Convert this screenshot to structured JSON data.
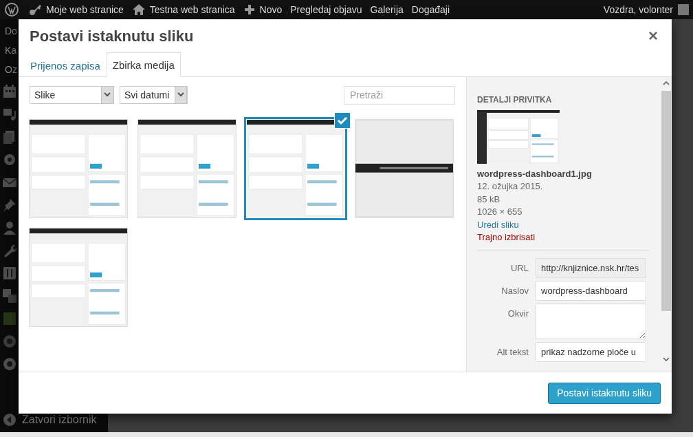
{
  "admin_bar": {
    "items": [
      {
        "kind": "logo"
      },
      {
        "kind": "sites",
        "label": "Moje web stranice"
      },
      {
        "kind": "home",
        "label": "Testna web stranica"
      },
      {
        "kind": "new",
        "label": "Novo"
      },
      {
        "kind": "link",
        "label": "Pregledaj objavu"
      },
      {
        "kind": "link",
        "label": "Galerija"
      },
      {
        "kind": "link",
        "label": "Događaji"
      }
    ],
    "user": "Vozdra, volonter"
  },
  "admin_menu": {
    "items": [
      "Do",
      "Ka",
      "Oz"
    ],
    "collapse": "Zatvori izbornik"
  },
  "modal": {
    "title": "Postavi istaknutu sliku",
    "close": "×",
    "tabs": [
      {
        "label": "Prijenos zapisa",
        "selected": false
      },
      {
        "label": "Zbirka medija",
        "selected": true
      }
    ],
    "filters": [
      {
        "value": "Slike"
      },
      {
        "value": "Svi datumi"
      }
    ],
    "search": {
      "placeholder": "Pretraži"
    },
    "attachments": [
      {
        "selected": false
      },
      {
        "selected": false
      },
      {
        "selected": true
      },
      {
        "selected": false
      },
      {
        "selected": false
      }
    ],
    "details": {
      "heading": "DETALJI PRIVITKA",
      "filename": "wordpress-dashboard1.jpg",
      "date": "12. ožujka 2015.",
      "size": "85 kB",
      "dimensions": "1026 × 655",
      "edit_link": "Uredi sliku",
      "delete_link": "Trajno izbrisati",
      "fields": [
        {
          "kind": "input",
          "label": "URL",
          "value": "http://knjiznice.nsk.hr/tes",
          "readonly": true
        },
        {
          "kind": "input",
          "label": "Naslov",
          "value": "wordpress-dashboard",
          "readonly": false
        },
        {
          "kind": "textarea",
          "label": "Okvir"
        },
        {
          "kind": "input",
          "label": "Alt tekst",
          "value": "prikaz nadzorne ploče u",
          "readonly": false
        }
      ]
    },
    "button": "Postavi istaknutu sliku"
  }
}
